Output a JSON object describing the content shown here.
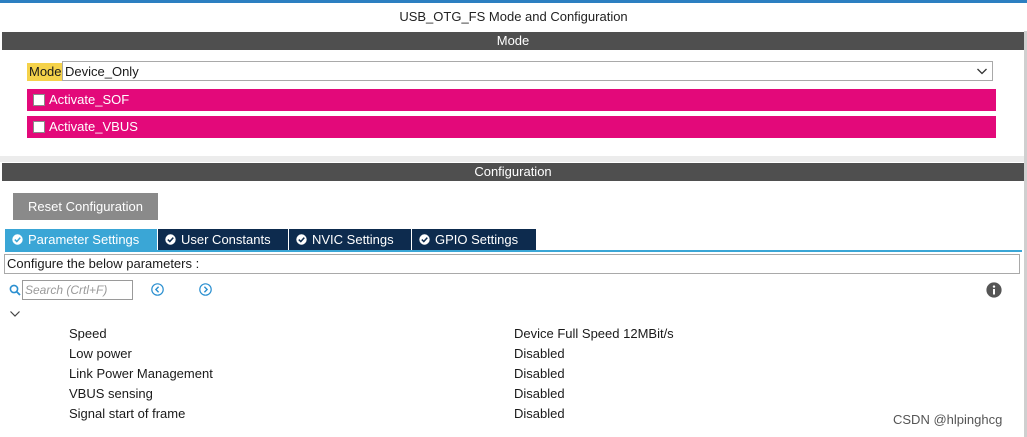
{
  "window": {
    "title": "USB_OTG_FS Mode and Configuration"
  },
  "mode_section": {
    "header": "Mode",
    "mode_label": "Mode",
    "mode_value": "Device_Only",
    "options": [
      {
        "label": "Activate_SOF",
        "checked": false
      },
      {
        "label": "Activate_VBUS",
        "checked": false
      }
    ]
  },
  "config_section": {
    "header": "Configuration",
    "reset_label": "Reset Configuration",
    "tabs": [
      {
        "label": "Parameter Settings",
        "active": true
      },
      {
        "label": "User Constants",
        "active": false
      },
      {
        "label": "NVIC Settings",
        "active": false
      },
      {
        "label": "GPIO Settings",
        "active": false
      }
    ],
    "instruction": "Configure the below parameters :",
    "search_placeholder": "Search (Crtl+F)",
    "parameters": [
      {
        "name": "Speed",
        "value": "Device Full Speed 12MBit/s"
      },
      {
        "name": "Low power",
        "value": "Disabled"
      },
      {
        "name": "Link Power Management",
        "value": "Disabled"
      },
      {
        "name": "VBUS sensing",
        "value": "Disabled"
      },
      {
        "name": "Signal start of frame",
        "value": "Disabled"
      }
    ]
  },
  "watermark": "CSDN @hlpinghcg",
  "colors": {
    "section_bar": "#4f4f4f",
    "highlight_pink": "#e3097a",
    "mode_label_yellow": "#f5d24a",
    "tab_active": "#3aa6d6",
    "tab_inactive": "#0d2b4e",
    "reset_button": "#8a8a8a"
  },
  "icons": {
    "tab": "check-circle-icon",
    "search": "search-icon",
    "prev": "chevron-left-circle-icon",
    "next": "chevron-right-circle-icon",
    "info": "info-icon",
    "collapse": "chevron-down-icon",
    "select": "chevron-down-icon"
  }
}
